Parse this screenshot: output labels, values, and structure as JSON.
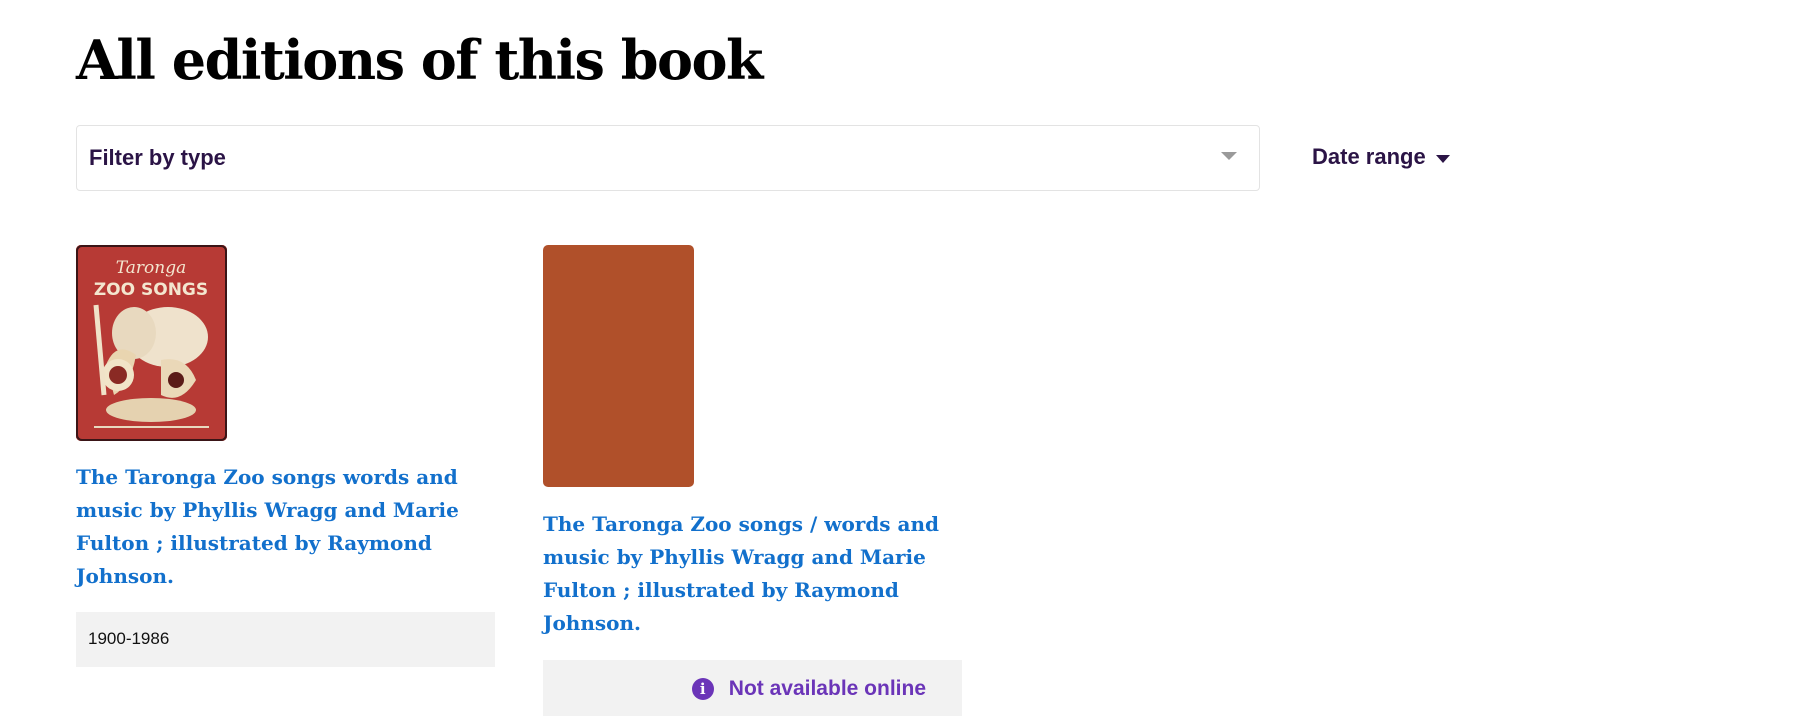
{
  "page": {
    "title": "All editions of this book"
  },
  "filters": {
    "type_label": "Filter by type",
    "date_range_label": "Date range"
  },
  "editions": [
    {
      "title": "The Taronga Zoo songs words and music by Phyllis Wragg and Marie Fulton ; illustrated by Raymond Johnson.",
      "cover_text_line1": "Taronga",
      "cover_text_line2": "ZOO SONGS",
      "cover_color": "#b73a35",
      "date": "1900-1986"
    },
    {
      "title": "The Taronga Zoo songs / words and music by Phyllis Wragg and Marie Fulton ; illustrated by Raymond Johnson.",
      "cover_color": "#b0502a",
      "availability": "Not available online",
      "availability_icon": "info-icon"
    }
  ],
  "colors": {
    "link": "#1270cc",
    "heading_purple": "#2b1446",
    "availability_purple": "#6b35b8",
    "info_bar_bg": "#f2f2f2"
  }
}
